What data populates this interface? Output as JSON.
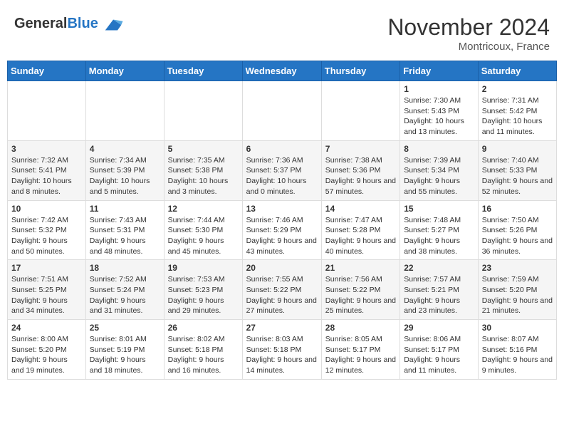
{
  "header": {
    "logo_general": "General",
    "logo_blue": "Blue",
    "month_title": "November 2024",
    "location": "Montricoux, France"
  },
  "days_of_week": [
    "Sunday",
    "Monday",
    "Tuesday",
    "Wednesday",
    "Thursday",
    "Friday",
    "Saturday"
  ],
  "weeks": [
    [
      {
        "day": "",
        "info": ""
      },
      {
        "day": "",
        "info": ""
      },
      {
        "day": "",
        "info": ""
      },
      {
        "day": "",
        "info": ""
      },
      {
        "day": "",
        "info": ""
      },
      {
        "day": "1",
        "info": "Sunrise: 7:30 AM\nSunset: 5:43 PM\nDaylight: 10 hours and 13 minutes."
      },
      {
        "day": "2",
        "info": "Sunrise: 7:31 AM\nSunset: 5:42 PM\nDaylight: 10 hours and 11 minutes."
      }
    ],
    [
      {
        "day": "3",
        "info": "Sunrise: 7:32 AM\nSunset: 5:41 PM\nDaylight: 10 hours and 8 minutes."
      },
      {
        "day": "4",
        "info": "Sunrise: 7:34 AM\nSunset: 5:39 PM\nDaylight: 10 hours and 5 minutes."
      },
      {
        "day": "5",
        "info": "Sunrise: 7:35 AM\nSunset: 5:38 PM\nDaylight: 10 hours and 3 minutes."
      },
      {
        "day": "6",
        "info": "Sunrise: 7:36 AM\nSunset: 5:37 PM\nDaylight: 10 hours and 0 minutes."
      },
      {
        "day": "7",
        "info": "Sunrise: 7:38 AM\nSunset: 5:36 PM\nDaylight: 9 hours and 57 minutes."
      },
      {
        "day": "8",
        "info": "Sunrise: 7:39 AM\nSunset: 5:34 PM\nDaylight: 9 hours and 55 minutes."
      },
      {
        "day": "9",
        "info": "Sunrise: 7:40 AM\nSunset: 5:33 PM\nDaylight: 9 hours and 52 minutes."
      }
    ],
    [
      {
        "day": "10",
        "info": "Sunrise: 7:42 AM\nSunset: 5:32 PM\nDaylight: 9 hours and 50 minutes."
      },
      {
        "day": "11",
        "info": "Sunrise: 7:43 AM\nSunset: 5:31 PM\nDaylight: 9 hours and 48 minutes."
      },
      {
        "day": "12",
        "info": "Sunrise: 7:44 AM\nSunset: 5:30 PM\nDaylight: 9 hours and 45 minutes."
      },
      {
        "day": "13",
        "info": "Sunrise: 7:46 AM\nSunset: 5:29 PM\nDaylight: 9 hours and 43 minutes."
      },
      {
        "day": "14",
        "info": "Sunrise: 7:47 AM\nSunset: 5:28 PM\nDaylight: 9 hours and 40 minutes."
      },
      {
        "day": "15",
        "info": "Sunrise: 7:48 AM\nSunset: 5:27 PM\nDaylight: 9 hours and 38 minutes."
      },
      {
        "day": "16",
        "info": "Sunrise: 7:50 AM\nSunset: 5:26 PM\nDaylight: 9 hours and 36 minutes."
      }
    ],
    [
      {
        "day": "17",
        "info": "Sunrise: 7:51 AM\nSunset: 5:25 PM\nDaylight: 9 hours and 34 minutes."
      },
      {
        "day": "18",
        "info": "Sunrise: 7:52 AM\nSunset: 5:24 PM\nDaylight: 9 hours and 31 minutes."
      },
      {
        "day": "19",
        "info": "Sunrise: 7:53 AM\nSunset: 5:23 PM\nDaylight: 9 hours and 29 minutes."
      },
      {
        "day": "20",
        "info": "Sunrise: 7:55 AM\nSunset: 5:22 PM\nDaylight: 9 hours and 27 minutes."
      },
      {
        "day": "21",
        "info": "Sunrise: 7:56 AM\nSunset: 5:22 PM\nDaylight: 9 hours and 25 minutes."
      },
      {
        "day": "22",
        "info": "Sunrise: 7:57 AM\nSunset: 5:21 PM\nDaylight: 9 hours and 23 minutes."
      },
      {
        "day": "23",
        "info": "Sunrise: 7:59 AM\nSunset: 5:20 PM\nDaylight: 9 hours and 21 minutes."
      }
    ],
    [
      {
        "day": "24",
        "info": "Sunrise: 8:00 AM\nSunset: 5:20 PM\nDaylight: 9 hours and 19 minutes."
      },
      {
        "day": "25",
        "info": "Sunrise: 8:01 AM\nSunset: 5:19 PM\nDaylight: 9 hours and 18 minutes."
      },
      {
        "day": "26",
        "info": "Sunrise: 8:02 AM\nSunset: 5:18 PM\nDaylight: 9 hours and 16 minutes."
      },
      {
        "day": "27",
        "info": "Sunrise: 8:03 AM\nSunset: 5:18 PM\nDaylight: 9 hours and 14 minutes."
      },
      {
        "day": "28",
        "info": "Sunrise: 8:05 AM\nSunset: 5:17 PM\nDaylight: 9 hours and 12 minutes."
      },
      {
        "day": "29",
        "info": "Sunrise: 8:06 AM\nSunset: 5:17 PM\nDaylight: 9 hours and 11 minutes."
      },
      {
        "day": "30",
        "info": "Sunrise: 8:07 AM\nSunset: 5:16 PM\nDaylight: 9 hours and 9 minutes."
      }
    ]
  ]
}
